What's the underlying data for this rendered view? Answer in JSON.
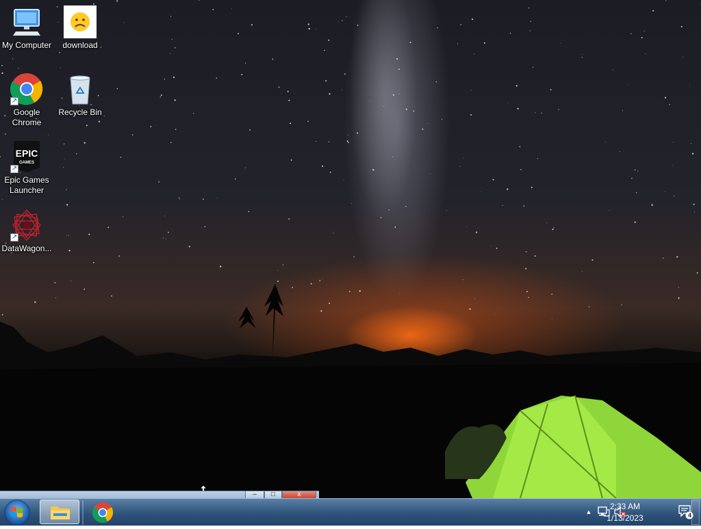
{
  "desktop": {
    "icons": [
      {
        "label": "My Computer",
        "icon": "computer-icon"
      },
      {
        "label": "download",
        "icon": "sad-face-icon"
      },
      {
        "label": "Google Chrome",
        "icon": "chrome-icon"
      },
      {
        "label": "Recycle Bin",
        "icon": "recycle-bin-icon"
      },
      {
        "label": "Epic Games Launcher",
        "icon": "epic-games-icon",
        "logo_text": "EPIC",
        "logo_subtext": "GAMES"
      },
      {
        "label": "DataWagon...",
        "icon": "datawagon-icon"
      }
    ]
  },
  "minimized_window": {
    "minimize_glyph": "–",
    "maximize_glyph": "□",
    "close_glyph": "x"
  },
  "taskbar": {
    "start_icon": "windows-start-icon",
    "items": [
      {
        "icon": "file-explorer-icon",
        "active": true
      },
      {
        "icon": "chrome-icon",
        "active": false
      }
    ],
    "tray": {
      "overflow_glyph": "▲",
      "network_icon": "network-icon",
      "volume_icon": "volume-muted-icon",
      "time": "2:33 AM",
      "date": "1/13/2023",
      "notification_count": "4"
    }
  },
  "colors": {
    "taskbar": "#2c5078",
    "tent": "#9be53a",
    "sunset_glow": "#ff6e14"
  }
}
